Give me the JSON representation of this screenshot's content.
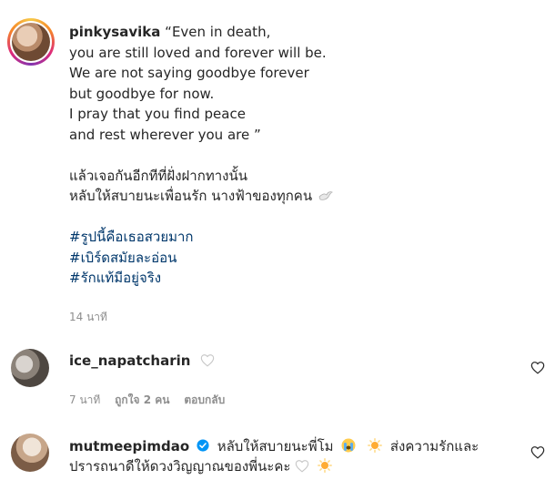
{
  "caption": {
    "username": "pinkysavika",
    "lines": [
      "“Even in death,",
      "you are still loved and forever will be.",
      "We are not saying goodbye forever",
      "but goodbye for now.",
      "I pray that you find peace",
      "and rest wherever you are ”"
    ],
    "thai_lines": [
      "แล้วเจอกันอีกทีที่ฝั่งฝากทางนั้น",
      "หลับให้สบายนะเพื่อนรัก นางฟ้าของทุกคน"
    ],
    "hashtags": [
      "#รูปนี้คือเธอสวยมาก",
      "#เบิร์ดสมัยละอ่อน",
      "#รักแท้มีอยู่จริง"
    ],
    "time": "14 นาที"
  },
  "comments": [
    {
      "username": "ice_napatcharin",
      "text": "",
      "time": "7 นาที",
      "likes": "ถูกใจ 2 คน",
      "reply": "ตอบกลับ"
    },
    {
      "username": "mutmeepimdao",
      "verified": true,
      "text_part1": "หลับให้สบายนะพี่โม",
      "text_part2": "ส่งความรักและ",
      "text_line2": "ปรารถนาดีให้ดวงวิญญาณของพี่นะคะ"
    }
  ],
  "icons": {
    "dove": "dove-icon",
    "heart": "heart-outline-icon",
    "verified": "verified-badge-icon",
    "crying_face": "crying-face-emoji",
    "sun": "sun-emoji"
  },
  "colors": {
    "text": "#262626",
    "muted": "#8e8e8e",
    "hashtag": "#00376b",
    "verified": "#0095f6"
  }
}
